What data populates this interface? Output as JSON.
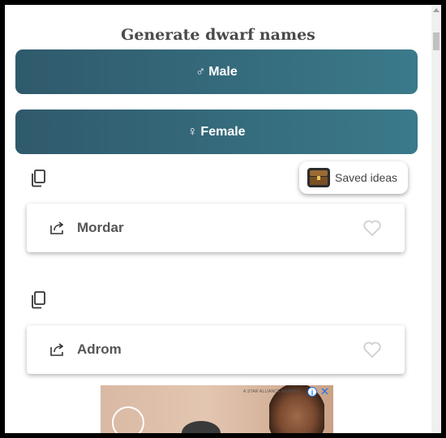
{
  "page": {
    "title": "Generate dwarf names"
  },
  "gender_buttons": {
    "male": {
      "symbol": "♂",
      "label": "Male"
    },
    "female": {
      "symbol": "♀",
      "label": "Female"
    }
  },
  "saved_ideas": {
    "label": "Saved ideas"
  },
  "names": [
    {
      "name": "Mordar"
    },
    {
      "name": "Adrom"
    }
  ],
  "ad": {
    "small_text": "A STAR ALLIANCE MEMBER",
    "info_symbol": "i",
    "close_symbol": "✕"
  },
  "colors": {
    "button_gradient_start": "#2f5a6c",
    "button_gradient_end": "#3a7a8a",
    "title_color": "#4a4a4a"
  }
}
